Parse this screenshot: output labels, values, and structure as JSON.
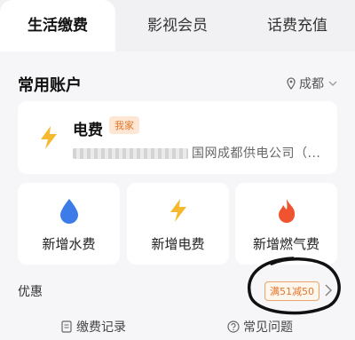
{
  "tabs": [
    {
      "label": "生活缴费"
    },
    {
      "label": "影视会员"
    },
    {
      "label": "话费充值"
    }
  ],
  "section": {
    "title": "常用账户",
    "location": "成都"
  },
  "account": {
    "name": "电费",
    "tag": "我家",
    "provider": "国网成都供电公司（..."
  },
  "services": [
    {
      "label": "新增水费",
      "icon": "water-drop-icon"
    },
    {
      "label": "新增电费",
      "icon": "lightning-icon"
    },
    {
      "label": "新增燃气费",
      "icon": "flame-icon"
    }
  ],
  "discount": {
    "title": "优惠",
    "coupon": "满51减50"
  },
  "footer": {
    "records": "缴费记录",
    "faq": "常见问题"
  },
  "colors": {
    "accent_orange": "#e0752b",
    "lightning_yellow": "#f5b82e",
    "water_blue": "#3c7be8",
    "flame_red": "#f0532f"
  }
}
